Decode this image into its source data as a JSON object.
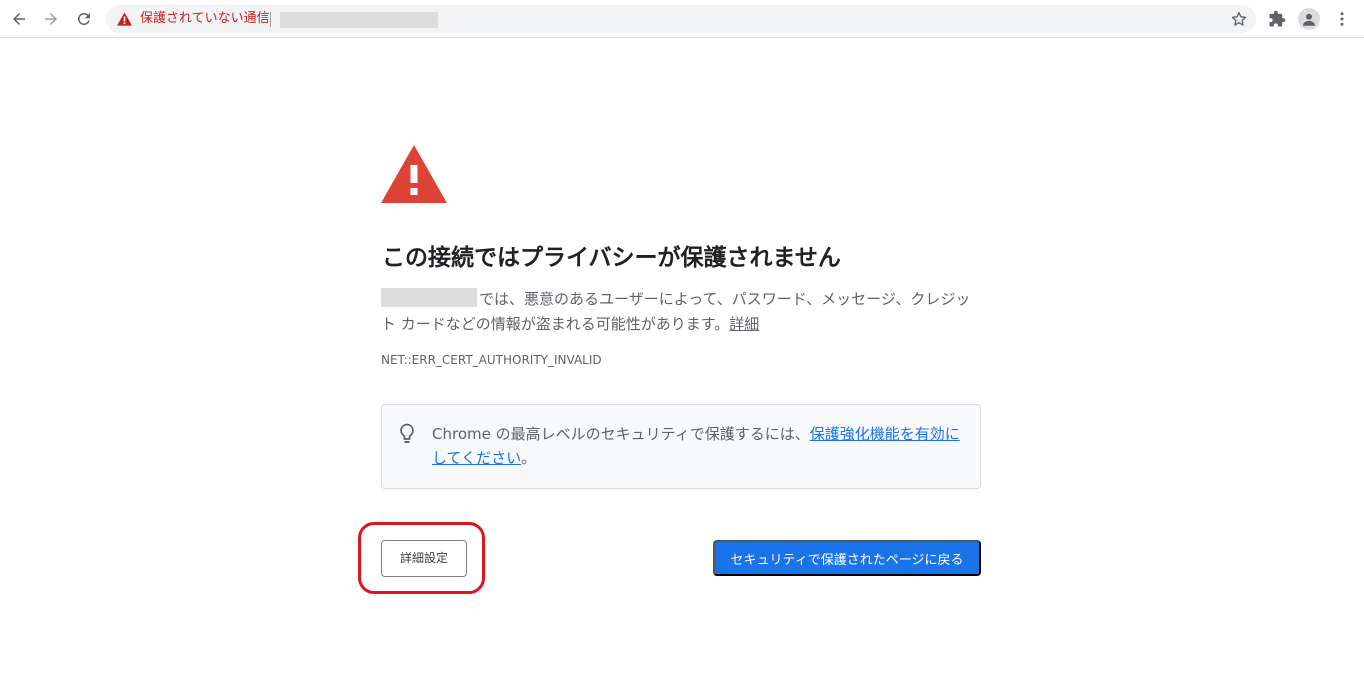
{
  "toolbar": {
    "back_icon": "arrow-left-icon",
    "forward_icon": "arrow-right-icon",
    "reload_icon": "reload-icon",
    "security_status": "保護されていない通信",
    "security_status_color": "#c5221f",
    "star_icon": "star-icon",
    "extensions_icon": "puzzle-icon",
    "profile_icon": "avatar-icon",
    "menu_icon": "kebab-menu-icon"
  },
  "interstitial": {
    "warning_icon": "warning-triangle-icon",
    "warning_color": "#db4437",
    "title": "この接続ではプライバシーが保護されません",
    "description": "では、悪意のあるユーザーによって、パスワード、メッセージ、クレジット カードなどの情報が盗まれる可能性があります。",
    "details_link": "詳細",
    "error_code": "NET::ERR_CERT_AUTHORITY_INVALID",
    "enhanced_protection": {
      "icon": "lightbulb-icon",
      "text": "Chrome の最高レベルのセキュリティで保護するには、",
      "link": "保護強化機能を有効にしてください",
      "suffix": "。"
    },
    "advanced_button": "詳細設定",
    "back_button": "セキュリティで保護されたページに戻る",
    "accent_color": "#1a73e8",
    "highlight_color": "#e0141e"
  }
}
